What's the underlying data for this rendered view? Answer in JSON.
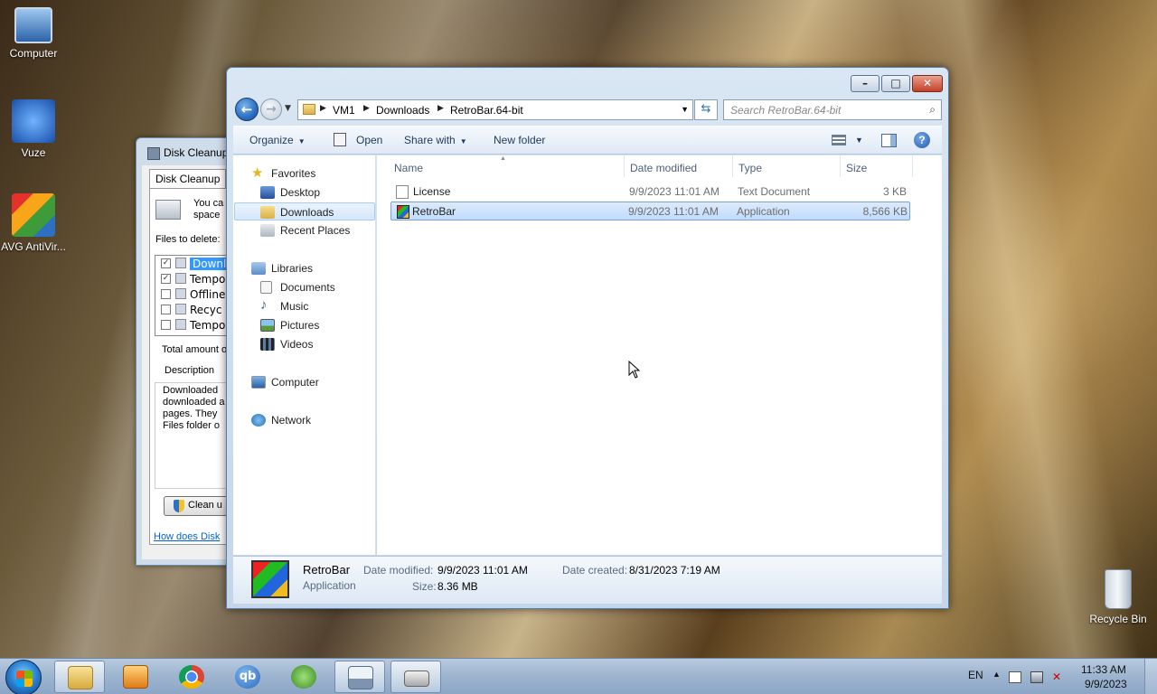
{
  "desktop": {
    "icons": [
      {
        "label": "Computer"
      },
      {
        "label": "Vuze"
      },
      {
        "label": "AVG AntiVir..."
      },
      {
        "label": "Recycle Bin"
      }
    ]
  },
  "disk_cleanup": {
    "title": "Disk Cleanup",
    "tab": "Disk Cleanup",
    "intro": "You ca",
    "intro2": "space",
    "files_label": "Files to delete:",
    "items": [
      {
        "label": "Downlo",
        "checked": true
      },
      {
        "label": "Tempo",
        "checked": true
      },
      {
        "label": "Offline",
        "checked": false
      },
      {
        "label": "Recyc",
        "checked": false
      },
      {
        "label": "Tempo",
        "checked": false
      }
    ],
    "total_label": "Total amount o",
    "description_label": "Description",
    "description_lines": [
      "Downloaded",
      "downloaded a",
      "pages. They",
      "Files folder o"
    ],
    "clean_button": "Clean u",
    "help_link": "How does Disk"
  },
  "explorer": {
    "breadcrumb": [
      "VM1",
      "Downloads",
      "RetroBar.64-bit"
    ],
    "search_placeholder": "Search RetroBar.64-bit",
    "toolbar": {
      "organize": "Organize",
      "open": "Open",
      "share_with": "Share with",
      "new_folder": "New folder"
    },
    "nav": {
      "favorites": "Favorites",
      "desktop": "Desktop",
      "downloads": "Downloads",
      "recent_places": "Recent Places",
      "libraries": "Libraries",
      "documents": "Documents",
      "music": "Music",
      "pictures": "Pictures",
      "videos": "Videos",
      "computer": "Computer",
      "network": "Network"
    },
    "columns": {
      "name": "Name",
      "date_modified": "Date modified",
      "type": "Type",
      "size": "Size"
    },
    "files": [
      {
        "name": "License",
        "date": "9/9/2023 11:01 AM",
        "type": "Text Document",
        "size": "3 KB"
      },
      {
        "name": "RetroBar",
        "date": "9/9/2023 11:01 AM",
        "type": "Application",
        "size": "8,566 KB"
      }
    ],
    "details": {
      "name": "RetroBar",
      "kind": "Application",
      "date_modified_label": "Date modified:",
      "date_modified": "9/9/2023 11:01 AM",
      "size_label": "Size:",
      "size": "8.36 MB",
      "date_created_label": "Date created:",
      "date_created": "8/31/2023 7:19 AM"
    }
  },
  "taskbar": {
    "language": "EN",
    "time": "11:33 AM",
    "date": "9/9/2023"
  },
  "colors": {
    "selection": "#c1dbfc",
    "link": "#0066cc"
  }
}
